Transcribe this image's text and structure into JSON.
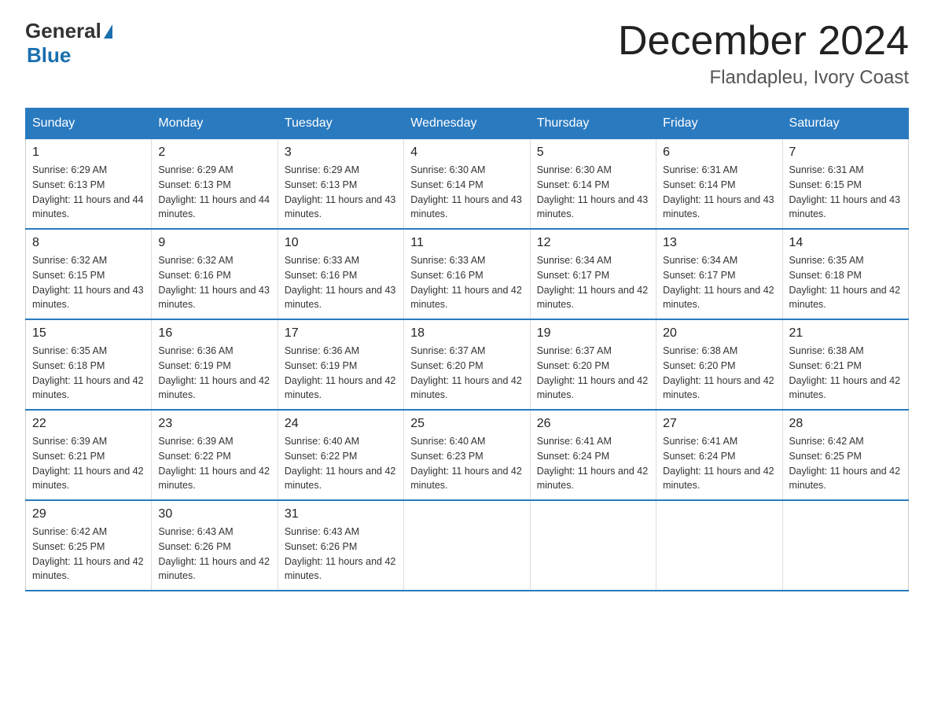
{
  "header": {
    "logo_general": "General",
    "logo_blue": "Blue",
    "month_title": "December 2024",
    "location": "Flandapleu, Ivory Coast"
  },
  "days_of_week": [
    "Sunday",
    "Monday",
    "Tuesday",
    "Wednesday",
    "Thursday",
    "Friday",
    "Saturday"
  ],
  "weeks": [
    [
      {
        "day": "1",
        "sunrise": "Sunrise: 6:29 AM",
        "sunset": "Sunset: 6:13 PM",
        "daylight": "Daylight: 11 hours and 44 minutes."
      },
      {
        "day": "2",
        "sunrise": "Sunrise: 6:29 AM",
        "sunset": "Sunset: 6:13 PM",
        "daylight": "Daylight: 11 hours and 44 minutes."
      },
      {
        "day": "3",
        "sunrise": "Sunrise: 6:29 AM",
        "sunset": "Sunset: 6:13 PM",
        "daylight": "Daylight: 11 hours and 43 minutes."
      },
      {
        "day": "4",
        "sunrise": "Sunrise: 6:30 AM",
        "sunset": "Sunset: 6:14 PM",
        "daylight": "Daylight: 11 hours and 43 minutes."
      },
      {
        "day": "5",
        "sunrise": "Sunrise: 6:30 AM",
        "sunset": "Sunset: 6:14 PM",
        "daylight": "Daylight: 11 hours and 43 minutes."
      },
      {
        "day": "6",
        "sunrise": "Sunrise: 6:31 AM",
        "sunset": "Sunset: 6:14 PM",
        "daylight": "Daylight: 11 hours and 43 minutes."
      },
      {
        "day": "7",
        "sunrise": "Sunrise: 6:31 AM",
        "sunset": "Sunset: 6:15 PM",
        "daylight": "Daylight: 11 hours and 43 minutes."
      }
    ],
    [
      {
        "day": "8",
        "sunrise": "Sunrise: 6:32 AM",
        "sunset": "Sunset: 6:15 PM",
        "daylight": "Daylight: 11 hours and 43 minutes."
      },
      {
        "day": "9",
        "sunrise": "Sunrise: 6:32 AM",
        "sunset": "Sunset: 6:16 PM",
        "daylight": "Daylight: 11 hours and 43 minutes."
      },
      {
        "day": "10",
        "sunrise": "Sunrise: 6:33 AM",
        "sunset": "Sunset: 6:16 PM",
        "daylight": "Daylight: 11 hours and 43 minutes."
      },
      {
        "day": "11",
        "sunrise": "Sunrise: 6:33 AM",
        "sunset": "Sunset: 6:16 PM",
        "daylight": "Daylight: 11 hours and 42 minutes."
      },
      {
        "day": "12",
        "sunrise": "Sunrise: 6:34 AM",
        "sunset": "Sunset: 6:17 PM",
        "daylight": "Daylight: 11 hours and 42 minutes."
      },
      {
        "day": "13",
        "sunrise": "Sunrise: 6:34 AM",
        "sunset": "Sunset: 6:17 PM",
        "daylight": "Daylight: 11 hours and 42 minutes."
      },
      {
        "day": "14",
        "sunrise": "Sunrise: 6:35 AM",
        "sunset": "Sunset: 6:18 PM",
        "daylight": "Daylight: 11 hours and 42 minutes."
      }
    ],
    [
      {
        "day": "15",
        "sunrise": "Sunrise: 6:35 AM",
        "sunset": "Sunset: 6:18 PM",
        "daylight": "Daylight: 11 hours and 42 minutes."
      },
      {
        "day": "16",
        "sunrise": "Sunrise: 6:36 AM",
        "sunset": "Sunset: 6:19 PM",
        "daylight": "Daylight: 11 hours and 42 minutes."
      },
      {
        "day": "17",
        "sunrise": "Sunrise: 6:36 AM",
        "sunset": "Sunset: 6:19 PM",
        "daylight": "Daylight: 11 hours and 42 minutes."
      },
      {
        "day": "18",
        "sunrise": "Sunrise: 6:37 AM",
        "sunset": "Sunset: 6:20 PM",
        "daylight": "Daylight: 11 hours and 42 minutes."
      },
      {
        "day": "19",
        "sunrise": "Sunrise: 6:37 AM",
        "sunset": "Sunset: 6:20 PM",
        "daylight": "Daylight: 11 hours and 42 minutes."
      },
      {
        "day": "20",
        "sunrise": "Sunrise: 6:38 AM",
        "sunset": "Sunset: 6:20 PM",
        "daylight": "Daylight: 11 hours and 42 minutes."
      },
      {
        "day": "21",
        "sunrise": "Sunrise: 6:38 AM",
        "sunset": "Sunset: 6:21 PM",
        "daylight": "Daylight: 11 hours and 42 minutes."
      }
    ],
    [
      {
        "day": "22",
        "sunrise": "Sunrise: 6:39 AM",
        "sunset": "Sunset: 6:21 PM",
        "daylight": "Daylight: 11 hours and 42 minutes."
      },
      {
        "day": "23",
        "sunrise": "Sunrise: 6:39 AM",
        "sunset": "Sunset: 6:22 PM",
        "daylight": "Daylight: 11 hours and 42 minutes."
      },
      {
        "day": "24",
        "sunrise": "Sunrise: 6:40 AM",
        "sunset": "Sunset: 6:22 PM",
        "daylight": "Daylight: 11 hours and 42 minutes."
      },
      {
        "day": "25",
        "sunrise": "Sunrise: 6:40 AM",
        "sunset": "Sunset: 6:23 PM",
        "daylight": "Daylight: 11 hours and 42 minutes."
      },
      {
        "day": "26",
        "sunrise": "Sunrise: 6:41 AM",
        "sunset": "Sunset: 6:24 PM",
        "daylight": "Daylight: 11 hours and 42 minutes."
      },
      {
        "day": "27",
        "sunrise": "Sunrise: 6:41 AM",
        "sunset": "Sunset: 6:24 PM",
        "daylight": "Daylight: 11 hours and 42 minutes."
      },
      {
        "day": "28",
        "sunrise": "Sunrise: 6:42 AM",
        "sunset": "Sunset: 6:25 PM",
        "daylight": "Daylight: 11 hours and 42 minutes."
      }
    ],
    [
      {
        "day": "29",
        "sunrise": "Sunrise: 6:42 AM",
        "sunset": "Sunset: 6:25 PM",
        "daylight": "Daylight: 11 hours and 42 minutes."
      },
      {
        "day": "30",
        "sunrise": "Sunrise: 6:43 AM",
        "sunset": "Sunset: 6:26 PM",
        "daylight": "Daylight: 11 hours and 42 minutes."
      },
      {
        "day": "31",
        "sunrise": "Sunrise: 6:43 AM",
        "sunset": "Sunset: 6:26 PM",
        "daylight": "Daylight: 11 hours and 42 minutes."
      },
      null,
      null,
      null,
      null
    ]
  ]
}
